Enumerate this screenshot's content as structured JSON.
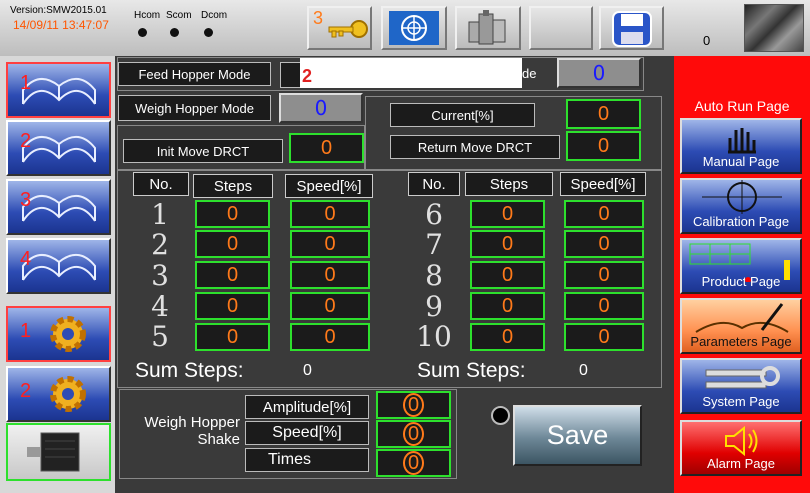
{
  "header": {
    "version": "Version:SMW2015.01",
    "datetime": "14/09/11 13:47:07",
    "status_labels": [
      "Hcom",
      "Scom",
      "Dcom"
    ],
    "key_badge": "3",
    "counter": "0",
    "icons": [
      "key-icon",
      "un-emblem-icon",
      "machine-icon",
      "blank-button",
      "save-disk-icon",
      "photo-thumbnail"
    ]
  },
  "left_nav": [
    {
      "num": "1",
      "icon": "book-icon"
    },
    {
      "num": "2",
      "icon": "book-icon"
    },
    {
      "num": "3",
      "icon": "book-icon"
    },
    {
      "num": "4",
      "icon": "book-icon"
    },
    {
      "num": "1",
      "icon": "gear-icon"
    },
    {
      "num": "2",
      "icon": "gear-icon"
    },
    {
      "num": "",
      "icon": "motor-icon"
    }
  ],
  "right_nav": {
    "current": "Auto Run Page",
    "items": [
      {
        "label": "Manual Page",
        "icon": "hand-icon"
      },
      {
        "label": "Calibration Page",
        "icon": "crosshair-icon"
      },
      {
        "label": "Product Page",
        "icon": "chart-icon"
      },
      {
        "label": "Parameters Page",
        "icon": "book-pen-icon"
      },
      {
        "label": "System Page",
        "icon": "tools-icon"
      },
      {
        "label": "Alarm Page",
        "icon": "speaker-icon"
      }
    ]
  },
  "top_settings": {
    "feed_hopper_label": "Feed Hopper Mode",
    "feed_hopper_popup": "2",
    "feed_hopper_tail": "de",
    "feed_hopper_value": "0",
    "weigh_hopper_label": "Weigh Hopper Mode",
    "weigh_hopper_value": "0",
    "current_label": "Current[%]",
    "current_value": "0",
    "init_move_label": "Init Move DRCT",
    "init_move_value": "0",
    "return_move_label": "Return Move DRCT",
    "return_move_value": "0"
  },
  "table": {
    "headers": [
      "No.",
      "Steps",
      "Speed[%]"
    ],
    "left_rows": [
      {
        "no": "1",
        "steps": "0",
        "speed": "0"
      },
      {
        "no": "2",
        "steps": "0",
        "speed": "0"
      },
      {
        "no": "3",
        "steps": "0",
        "speed": "0"
      },
      {
        "no": "4",
        "steps": "0",
        "speed": "0"
      },
      {
        "no": "5",
        "steps": "0",
        "speed": "0"
      }
    ],
    "right_rows": [
      {
        "no": "6",
        "steps": "0",
        "speed": "0"
      },
      {
        "no": "7",
        "steps": "0",
        "speed": "0"
      },
      {
        "no": "8",
        "steps": "0",
        "speed": "0"
      },
      {
        "no": "9",
        "steps": "0",
        "speed": "0"
      },
      {
        "no": "10",
        "steps": "0",
        "speed": "0"
      }
    ],
    "sum_label": "Sum Steps:",
    "sum_left": "0",
    "sum_right": "0"
  },
  "shake": {
    "title": "Weigh Hopper\nShake",
    "amplitude_label": "Amplitude[%]",
    "amplitude_value": "0",
    "speed_label": "Speed[%]",
    "speed_value": "0",
    "times_label": "Times",
    "times_value": "0"
  },
  "save_label": "Save",
  "colors": {
    "accent_green": "#2de02d",
    "value_orange": "#ff7a1a",
    "nav_blue": "#2d4cb4",
    "nav_red": "#ff0a0a"
  }
}
